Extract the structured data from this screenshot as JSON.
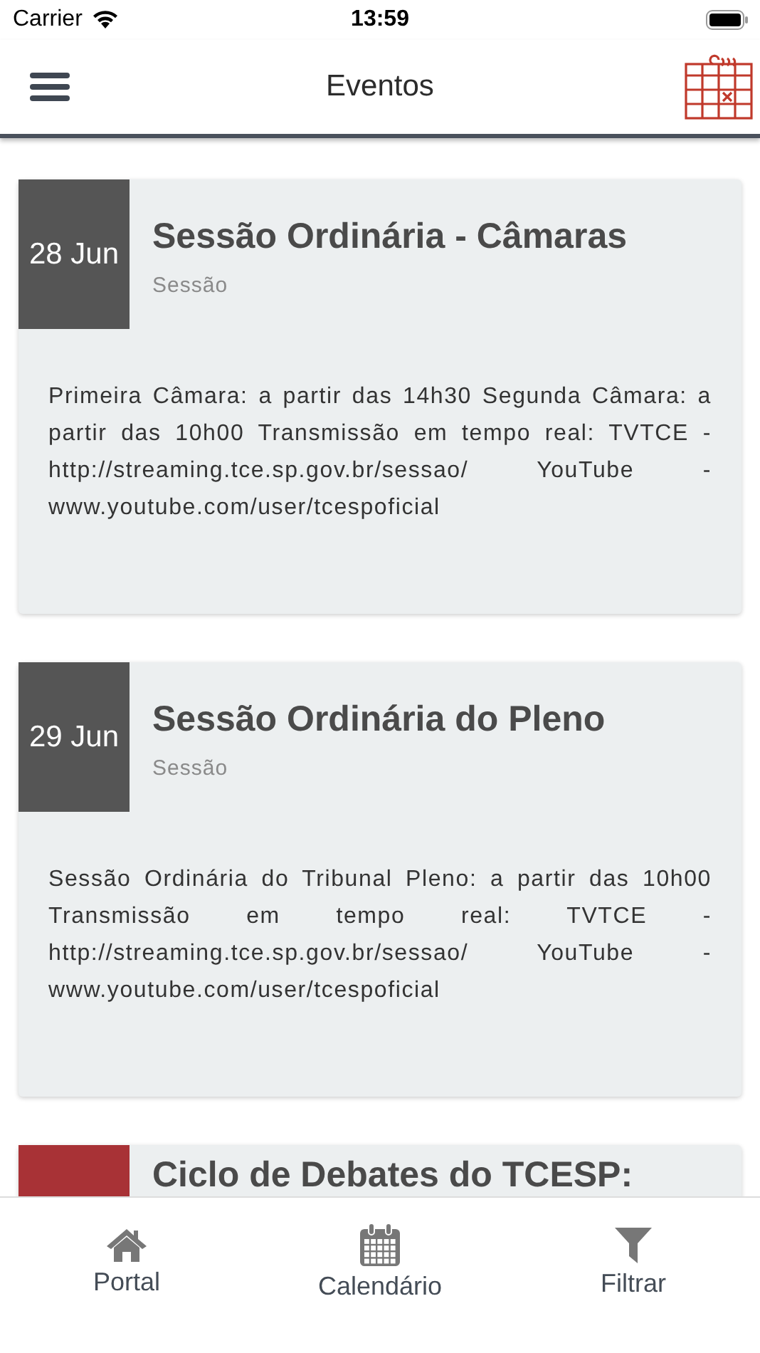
{
  "status_bar": {
    "carrier": "Carrier",
    "time": "13:59"
  },
  "header": {
    "title": "Eventos"
  },
  "events": [
    {
      "date": "28 Jun",
      "color": "#555555",
      "title": "Sessão Ordinária - Câmaras",
      "category": "Sessão",
      "description": "Primeira Câmara: a partir das 14h30 Segunda Câmara: a partir das 10h00 Transmissão em tempo real: TVTCE - http://streaming.tce.sp.gov.br/sessao/ YouTube - www.youtube.com/user/tcespoficial"
    },
    {
      "date": "29 Jun",
      "color": "#555555",
      "title": "Sessão Ordinária do Pleno",
      "category": "Sessão",
      "description": "Sessão Ordinária do Tribunal Pleno: a partir das 10h00 Transmissão em tempo real: TVTCE - http://streaming.tce.sp.gov.br/sessao/ YouTube - www.youtube.com/user/tcespoficial"
    },
    {
      "color": "#a83236",
      "title": "Ciclo de Debates do TCESP:"
    }
  ],
  "tab_bar": [
    {
      "label": "Portal",
      "kind": "home"
    },
    {
      "label": "Calendário",
      "kind": "calendar"
    },
    {
      "label": "Filtrar",
      "kind": "filter"
    }
  ]
}
